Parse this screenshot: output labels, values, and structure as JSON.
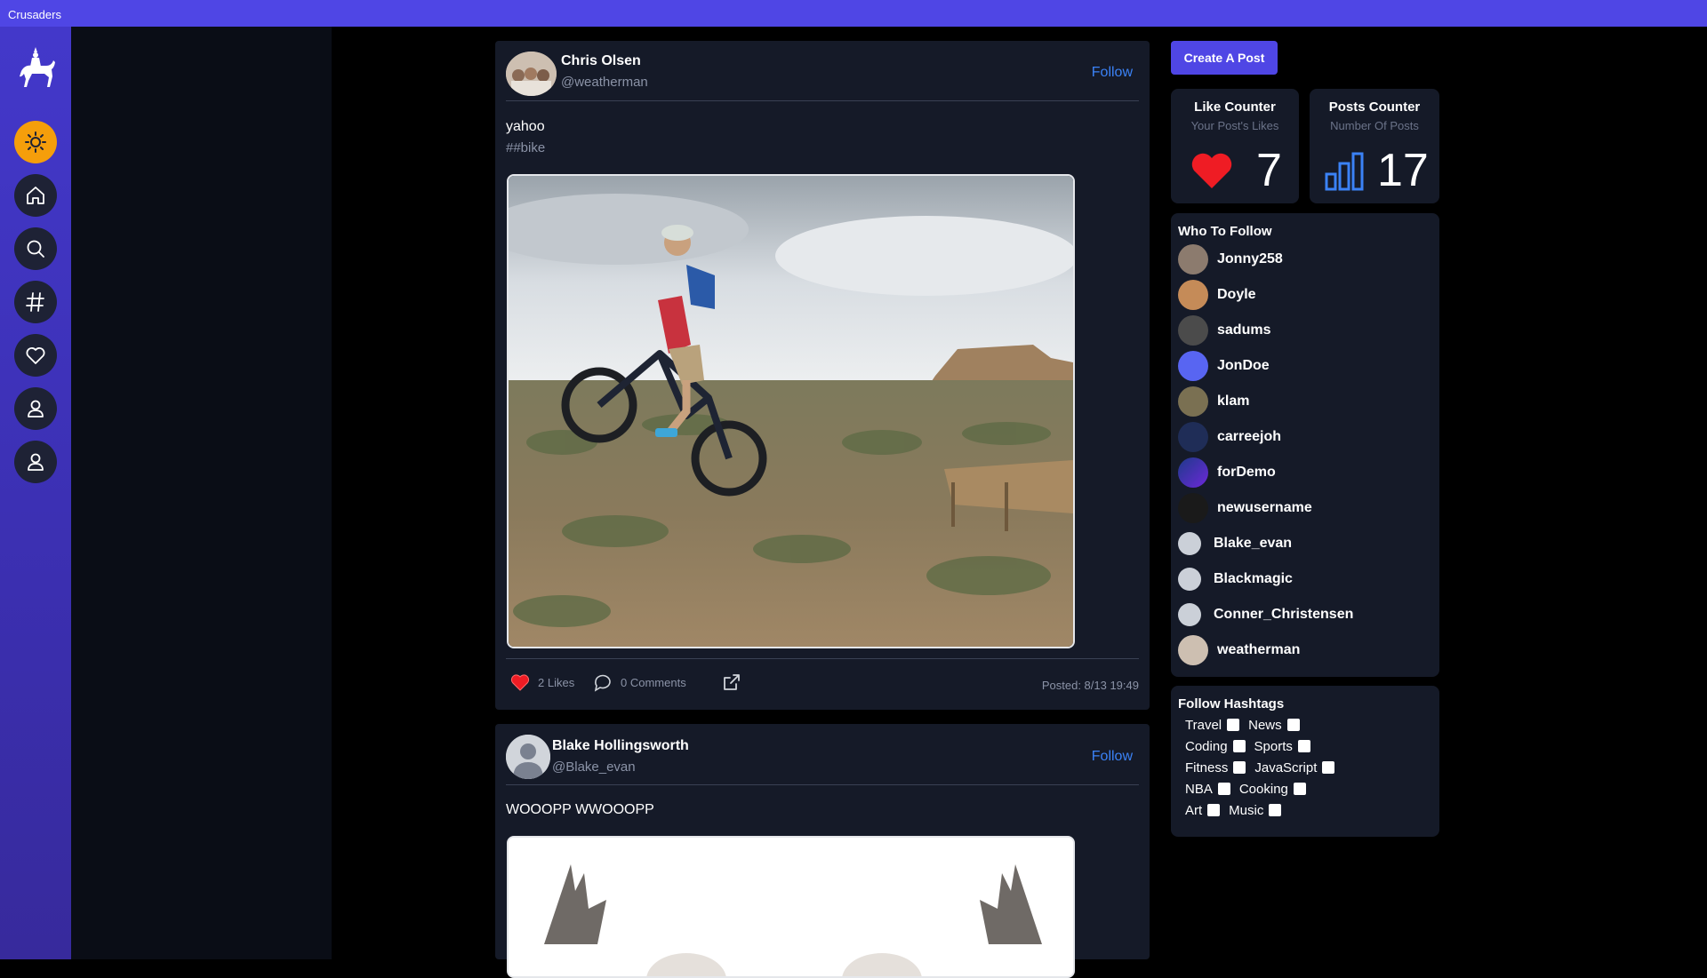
{
  "app": {
    "title": "Crusaders"
  },
  "sidebar": {
    "items": [
      {
        "name": "theme-toggle",
        "icon": "sun-icon"
      },
      {
        "name": "home",
        "icon": "home-icon"
      },
      {
        "name": "search",
        "icon": "search-icon"
      },
      {
        "name": "hashtags",
        "icon": "hashtag-icon"
      },
      {
        "name": "likes",
        "icon": "heart-icon"
      },
      {
        "name": "profile",
        "icon": "user-icon"
      },
      {
        "name": "account",
        "icon": "user-icon"
      }
    ]
  },
  "posts": [
    {
      "name": "Chris Olsen",
      "handle": "@weatherman",
      "follow_label": "Follow",
      "text": "yahoo",
      "tag": "##bike",
      "likes": "2 Likes",
      "comments": "0 Comments",
      "posted": "Posted: 8/13 19:49"
    },
    {
      "name": "Blake Hollingsworth",
      "handle": "@Blake_evan",
      "follow_label": "Follow",
      "text": "WOOOPP WWOOOPP"
    }
  ],
  "right": {
    "create_label": "Create A Post",
    "like_counter": {
      "title": "Like Counter",
      "subtitle": "Your Post's Likes",
      "value": "7"
    },
    "posts_counter": {
      "title": "Posts Counter",
      "subtitle": "Number Of Posts",
      "value": "17"
    },
    "who_to_follow": {
      "title": "Who To Follow",
      "users": [
        "Jonny258",
        "Doyle",
        "sadums",
        "JonDoe",
        "klam",
        "carreejoh",
        "forDemo",
        "newusername",
        "Blake_evan",
        "Blackmagic",
        "Conner_Christensen",
        "weatherman"
      ]
    },
    "follow_hashtags": {
      "title": "Follow Hashtags",
      "rows": [
        [
          "Travel",
          "News"
        ],
        [
          "Coding",
          "Sports"
        ],
        [
          "Fitness",
          "JavaScript"
        ],
        [
          "NBA",
          "Cooking"
        ],
        [
          "Art",
          "Music"
        ]
      ]
    }
  },
  "colors": {
    "accent": "#4f46e5",
    "link": "#3b82f6",
    "card": "#151a28",
    "heart": "#ef1c24"
  }
}
